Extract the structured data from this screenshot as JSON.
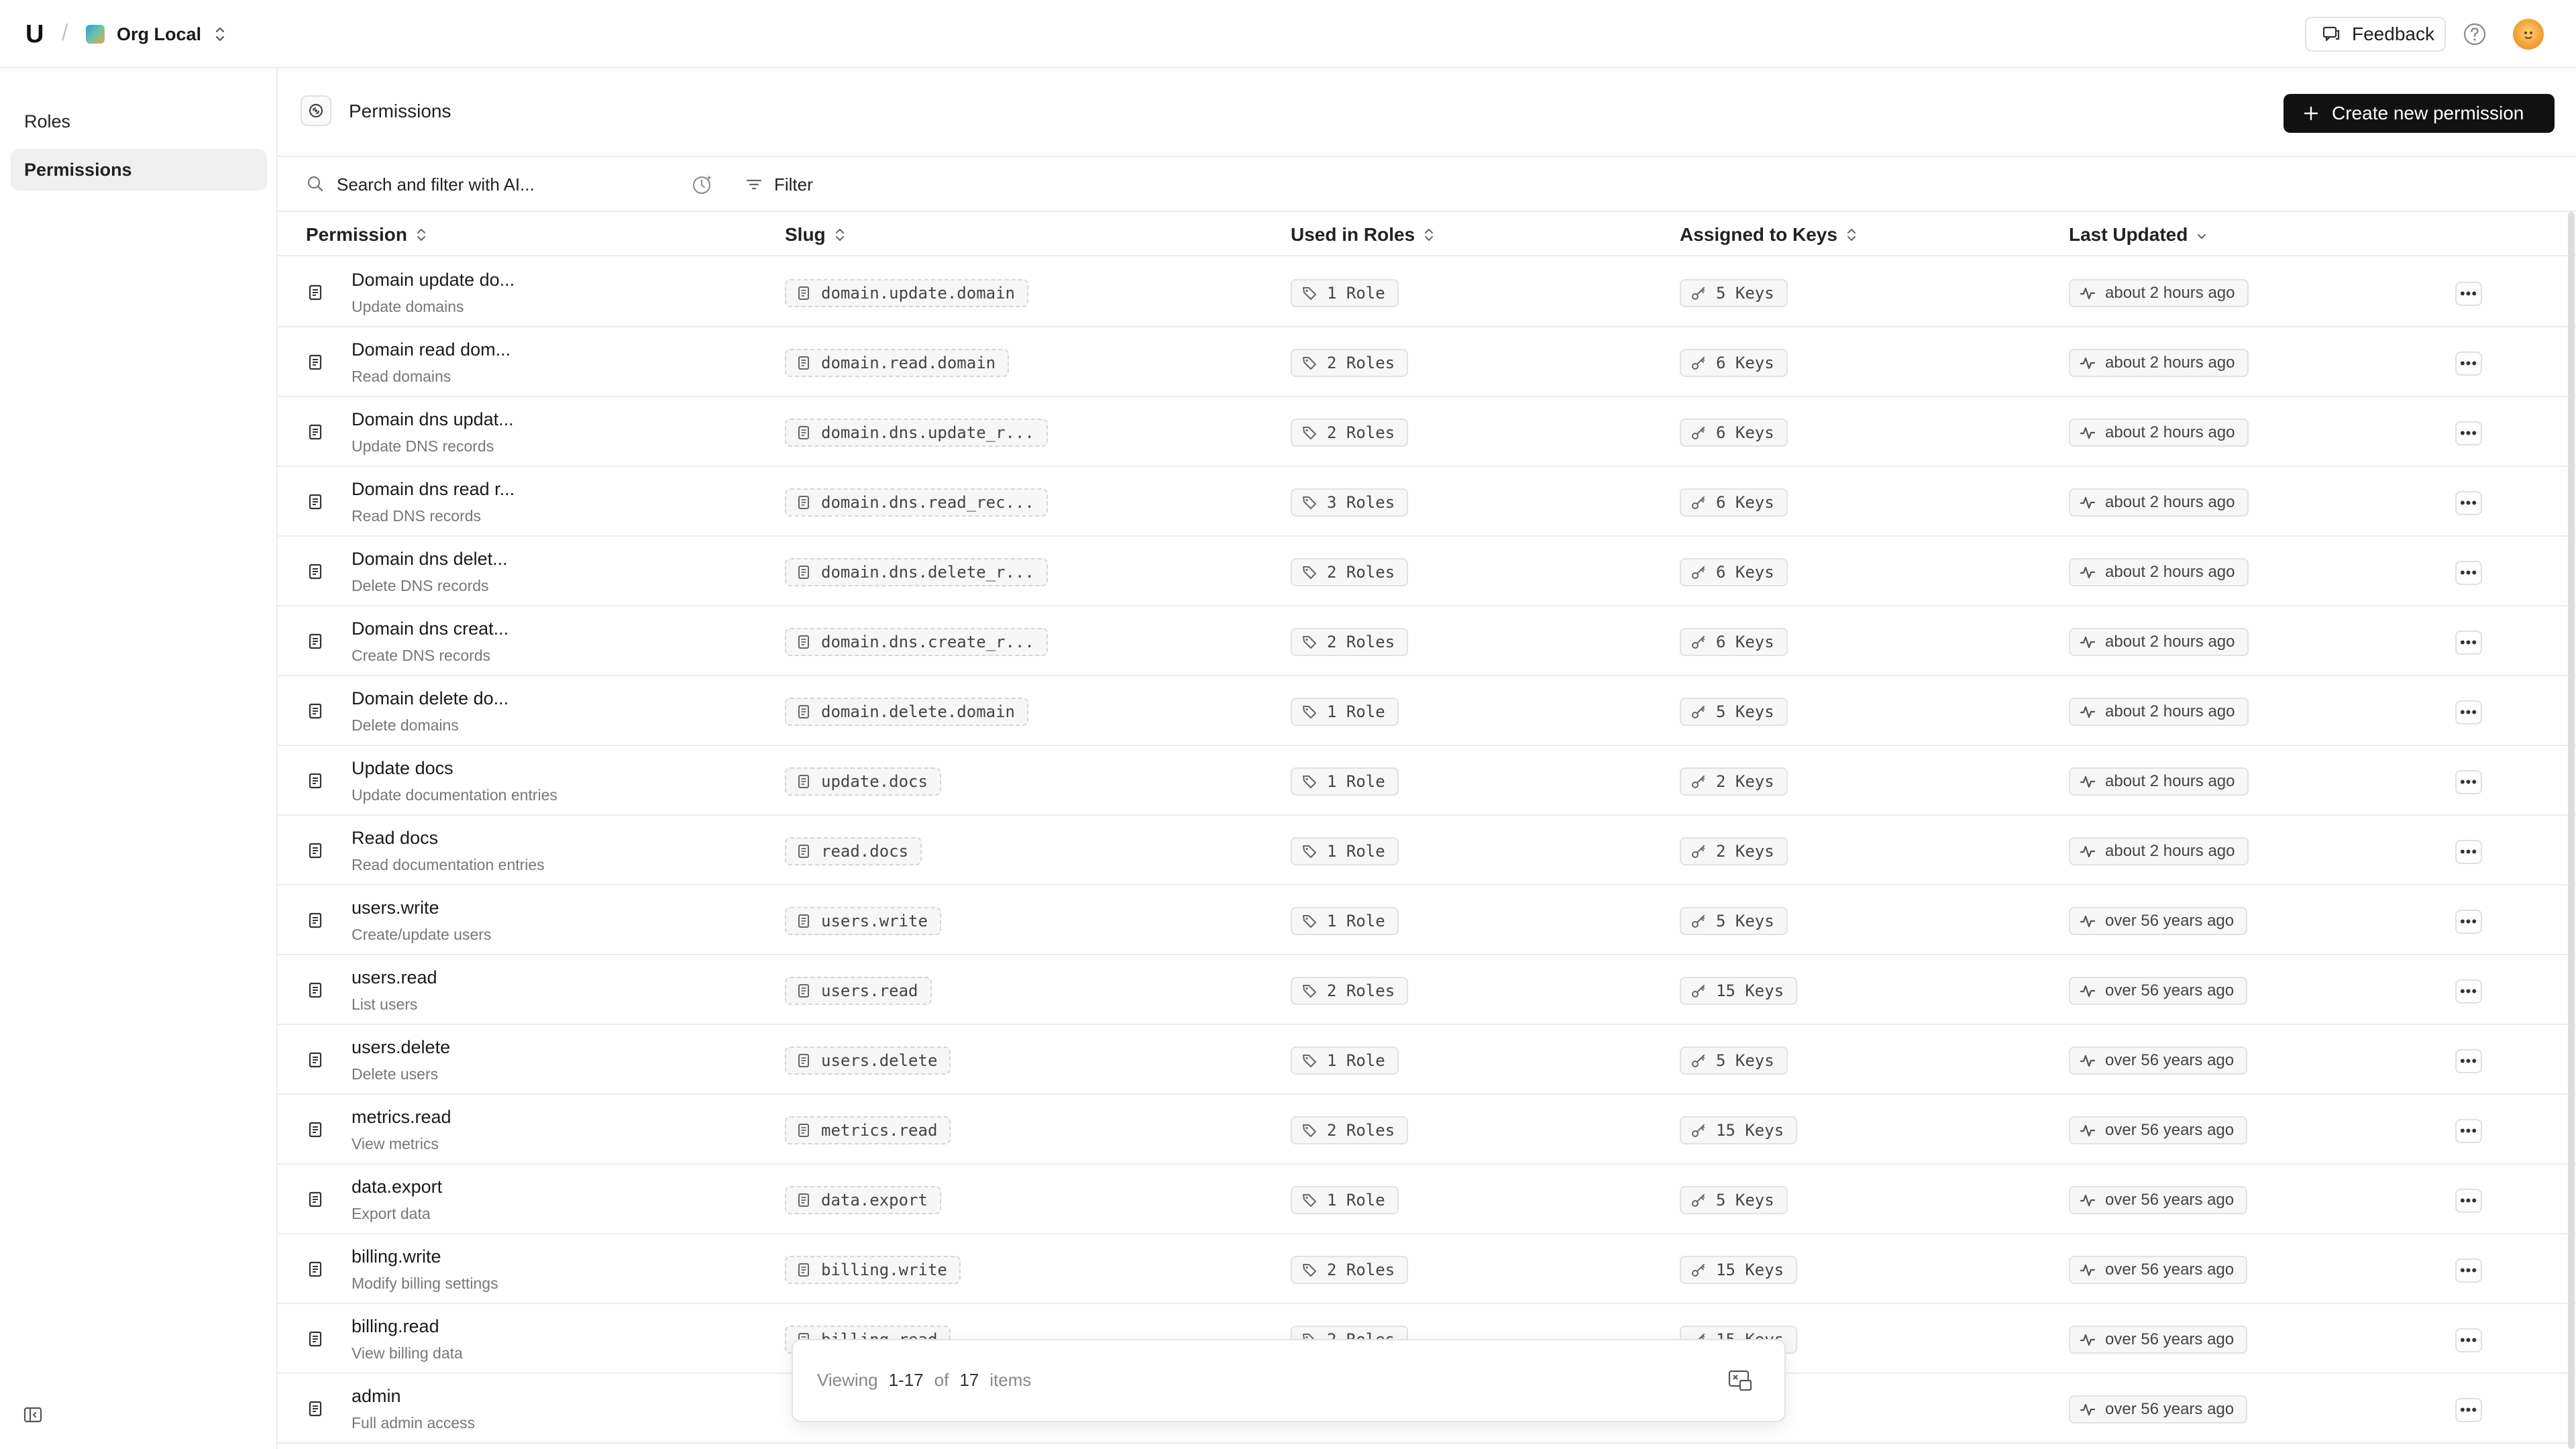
{
  "topbar": {
    "logo": "U",
    "separator": "/",
    "org_name": "Org Local",
    "feedback_label": "Feedback"
  },
  "sidebar": {
    "items": [
      {
        "label": "Roles",
        "active": false
      },
      {
        "label": "Permissions",
        "active": true
      }
    ]
  },
  "page": {
    "title": "Permissions",
    "create_label": "Create new permission"
  },
  "filterbar": {
    "search_placeholder": "Search and filter with AI...",
    "filter_label": "Filter"
  },
  "table": {
    "columns": [
      "Permission",
      "Slug",
      "Used in Roles",
      "Assigned to Keys",
      "Last Updated"
    ],
    "rows": [
      {
        "name": "Domain update do...",
        "desc": "Update domains",
        "slug": "domain.update.domain",
        "roles": "1 Role",
        "keys": "5 Keys",
        "updated": "about 2 hours ago"
      },
      {
        "name": "Domain read dom...",
        "desc": "Read domains",
        "slug": "domain.read.domain",
        "roles": "2 Roles",
        "keys": "6 Keys",
        "updated": "about 2 hours ago"
      },
      {
        "name": "Domain dns updat...",
        "desc": "Update DNS records",
        "slug": "domain.dns.update_r...",
        "roles": "2 Roles",
        "keys": "6 Keys",
        "updated": "about 2 hours ago"
      },
      {
        "name": "Domain dns read r...",
        "desc": "Read DNS records",
        "slug": "domain.dns.read_rec...",
        "roles": "3 Roles",
        "keys": "6 Keys",
        "updated": "about 2 hours ago"
      },
      {
        "name": "Domain dns delet...",
        "desc": "Delete DNS records",
        "slug": "domain.dns.delete_r...",
        "roles": "2 Roles",
        "keys": "6 Keys",
        "updated": "about 2 hours ago"
      },
      {
        "name": "Domain dns creat...",
        "desc": "Create DNS records",
        "slug": "domain.dns.create_r...",
        "roles": "2 Roles",
        "keys": "6 Keys",
        "updated": "about 2 hours ago"
      },
      {
        "name": "Domain delete do...",
        "desc": "Delete domains",
        "slug": "domain.delete.domain",
        "roles": "1 Role",
        "keys": "5 Keys",
        "updated": "about 2 hours ago"
      },
      {
        "name": "Update docs",
        "desc": "Update documentation entries",
        "slug": "update.docs",
        "roles": "1 Role",
        "keys": "2 Keys",
        "updated": "about 2 hours ago"
      },
      {
        "name": "Read docs",
        "desc": "Read documentation entries",
        "slug": "read.docs",
        "roles": "1 Role",
        "keys": "2 Keys",
        "updated": "about 2 hours ago"
      },
      {
        "name": "users.write",
        "desc": "Create/update users",
        "slug": "users.write",
        "roles": "1 Role",
        "keys": "5 Keys",
        "updated": "over 56 years ago"
      },
      {
        "name": "users.read",
        "desc": "List users",
        "slug": "users.read",
        "roles": "2 Roles",
        "keys": "15 Keys",
        "updated": "over 56 years ago"
      },
      {
        "name": "users.delete",
        "desc": "Delete users",
        "slug": "users.delete",
        "roles": "1 Role",
        "keys": "5 Keys",
        "updated": "over 56 years ago"
      },
      {
        "name": "metrics.read",
        "desc": "View metrics",
        "slug": "metrics.read",
        "roles": "2 Roles",
        "keys": "15 Keys",
        "updated": "over 56 years ago"
      },
      {
        "name": "data.export",
        "desc": "Export data",
        "slug": "data.export",
        "roles": "1 Role",
        "keys": "5 Keys",
        "updated": "over 56 years ago"
      },
      {
        "name": "billing.write",
        "desc": "Modify billing settings",
        "slug": "billing.write",
        "roles": "2 Roles",
        "keys": "15 Keys",
        "updated": "over 56 years ago"
      },
      {
        "name": "billing.read",
        "desc": "View billing data",
        "slug": "billing.read",
        "roles": "2 Roles",
        "keys": "15 Keys",
        "updated": "over 56 years ago"
      },
      {
        "name": "admin",
        "desc": "Full admin access",
        "slug": "",
        "roles": "",
        "keys": "",
        "updated": "over 56 years ago"
      }
    ]
  },
  "pager": {
    "viewing": "Viewing",
    "range": "1-17",
    "of": "of",
    "total": "17",
    "items": "items"
  },
  "icons": {
    "row": "file-text-icon",
    "slug": "file-icon",
    "roles": "tag-icon",
    "keys": "key-icon",
    "updated": "activity-icon"
  }
}
